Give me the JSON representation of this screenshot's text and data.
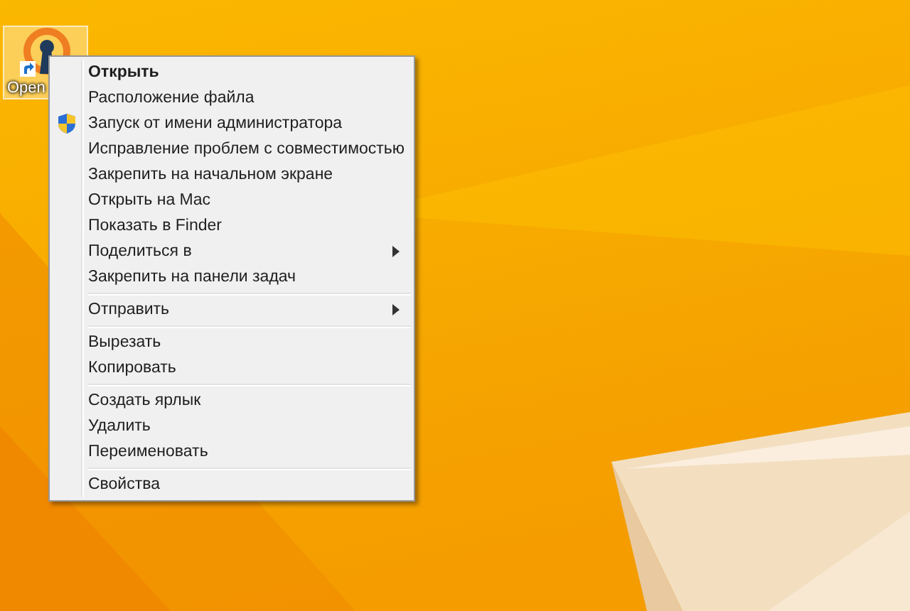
{
  "desktop_icon": {
    "label": "Open",
    "selected": true
  },
  "context_menu": {
    "sections": [
      {
        "items": [
          {
            "label": "Открыть",
            "kind": "plain",
            "default": true
          },
          {
            "label": "Расположение файла",
            "kind": "plain",
            "default": false
          },
          {
            "label": "Запуск от имени администратора",
            "kind": "shield",
            "default": false
          },
          {
            "label": "Исправление проблем с совместимостью",
            "kind": "plain",
            "default": false
          },
          {
            "label": "Закрепить на начальном экране",
            "kind": "plain",
            "default": false
          },
          {
            "label": "Открыть на Mac",
            "kind": "plain",
            "default": false
          },
          {
            "label": "Показать в Finder",
            "kind": "plain",
            "default": false
          },
          {
            "label": "Поделиться в",
            "kind": "submenu",
            "default": false
          },
          {
            "label": "Закрепить на панели задач",
            "kind": "plain",
            "default": false
          }
        ]
      },
      {
        "items": [
          {
            "label": "Отправить",
            "kind": "submenu",
            "default": false
          }
        ]
      },
      {
        "items": [
          {
            "label": "Вырезать",
            "kind": "plain",
            "default": false
          },
          {
            "label": "Копировать",
            "kind": "plain",
            "default": false
          }
        ]
      },
      {
        "items": [
          {
            "label": "Создать ярлык",
            "kind": "plain",
            "default": false
          },
          {
            "label": "Удалить",
            "kind": "plain",
            "default": false
          },
          {
            "label": "Переименовать",
            "kind": "plain",
            "default": false
          }
        ]
      },
      {
        "items": [
          {
            "label": "Свойства",
            "kind": "plain",
            "default": false
          }
        ]
      }
    ]
  }
}
